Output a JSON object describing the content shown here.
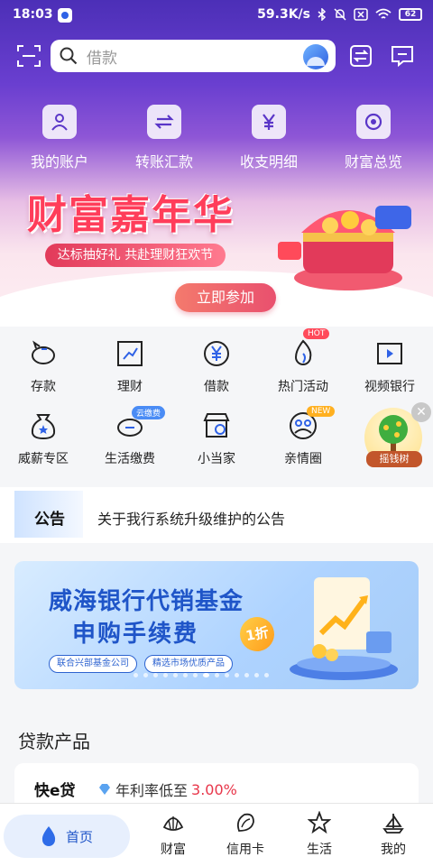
{
  "status_bar": {
    "time": "18:03",
    "network_speed": "59.3K/s",
    "battery": "62"
  },
  "search": {
    "placeholder": "借款"
  },
  "quick_actions": [
    {
      "label": "我的账户",
      "icon": "user-account-icon"
    },
    {
      "label": "转账汇款",
      "icon": "transfer-icon"
    },
    {
      "label": "收支明细",
      "icon": "yuan-statement-icon"
    },
    {
      "label": "财富总览",
      "icon": "wealth-overview-icon"
    }
  ],
  "promo_banner": {
    "title": "财富嘉年华",
    "subtitle": "达标抽好礼 共赴理财狂欢节",
    "button": "立即参加"
  },
  "service_grid": {
    "row1": [
      {
        "label": "存款",
        "icon": "piggy-bank-icon"
      },
      {
        "label": "理财",
        "icon": "chart-trend-icon"
      },
      {
        "label": "借款",
        "icon": "yuan-loan-icon"
      },
      {
        "label": "热门活动",
        "icon": "flame-icon",
        "tag": "HOT"
      },
      {
        "label": "视频银行",
        "icon": "video-icon"
      }
    ],
    "row2": [
      {
        "label": "威薪专区",
        "icon": "star-bag-icon"
      },
      {
        "label": "生活缴费",
        "icon": "payment-icon",
        "tag": "云缴费"
      },
      {
        "label": "小当家",
        "icon": "shop-icon"
      },
      {
        "label": "亲情圈",
        "icon": "family-icon",
        "tag": "NEW"
      }
    ],
    "floating_tree": {
      "label": "摇钱树"
    }
  },
  "notice": {
    "tag": "公告",
    "text": "关于我行系统升级维护的公告"
  },
  "fund_banner": {
    "line1": "威海银行代销基金",
    "line2": "申购手续费",
    "discount": "1折",
    "tags": [
      "联合兴部基金公司",
      "精选市场优质产品"
    ]
  },
  "loan_section": {
    "title": "贷款产品",
    "product_name": "快e贷",
    "rate_label": "年利率低至",
    "rate_value": "3.00%"
  },
  "tab_bar": [
    {
      "label": "首页",
      "icon": "water-drop-icon",
      "active": true
    },
    {
      "label": "财富",
      "icon": "shell-icon"
    },
    {
      "label": "信用卡",
      "icon": "conch-icon"
    },
    {
      "label": "生活",
      "icon": "starfish-icon"
    },
    {
      "label": "我的",
      "icon": "sailboat-icon"
    }
  ],
  "colors": {
    "brand_blue": "#1f55c8",
    "hero_purple": "#5a36c8",
    "accent_red": "#e8364a"
  }
}
